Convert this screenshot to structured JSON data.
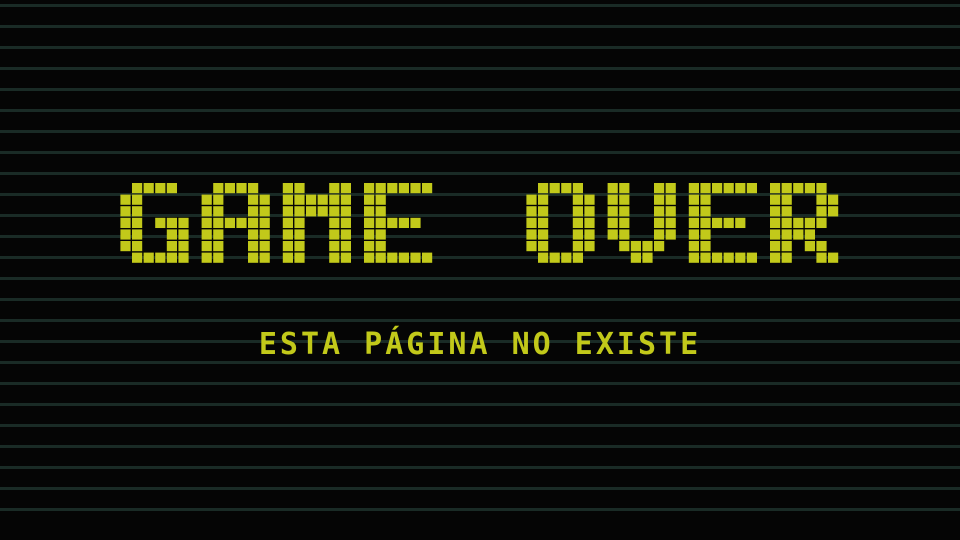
{
  "screen": {
    "title": "GAME OVER",
    "subtitle": "ESTA PÁGINA NO EXISTE"
  },
  "colors": {
    "background": "#050505",
    "scanline": "#1a2b26",
    "text": "#c2c91a",
    "grid": "#050505"
  }
}
